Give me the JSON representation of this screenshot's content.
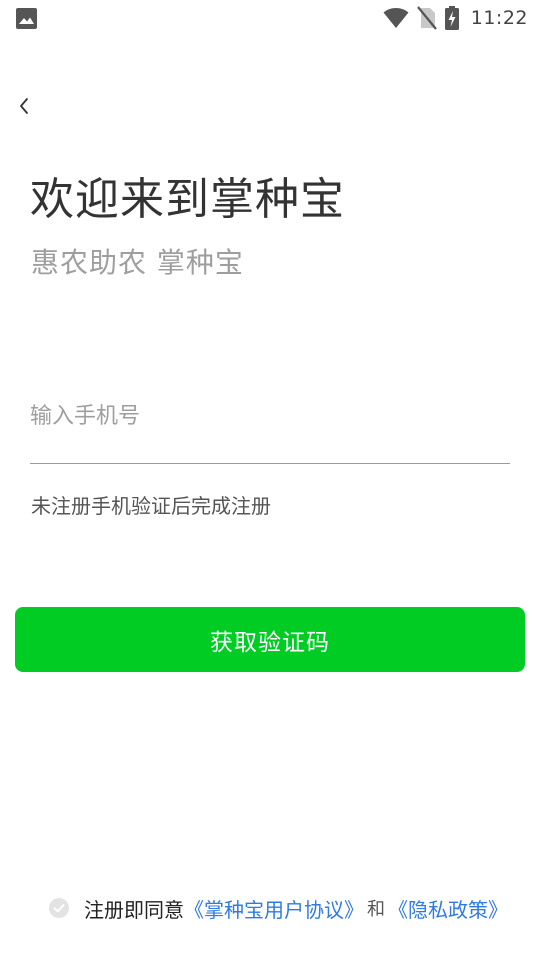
{
  "status_bar": {
    "time": "11:22",
    "icons": [
      "image-icon",
      "wifi-icon",
      "no-sim-icon",
      "battery-charging-icon"
    ]
  },
  "back_icon": "chevron-left-icon",
  "header": {
    "title": "欢迎来到掌种宝",
    "subtitle": "惠农助农 掌种宝"
  },
  "form": {
    "phone_placeholder": "输入手机号",
    "phone_value": "",
    "hint": "未注册手机验证后完成注册",
    "get_code_label": "获取验证码"
  },
  "agreement": {
    "checkbox_icon": "check-circle-icon",
    "checked": false,
    "prefix": "注册即同意",
    "user_agreement_link": "《掌种宝用户协议》",
    "and": "和",
    "privacy_link": "《隐私政策》"
  },
  "colors": {
    "accent": "#00cc24",
    "link": "#2f7be0",
    "title": "#333333",
    "muted": "#9e9e9e"
  }
}
